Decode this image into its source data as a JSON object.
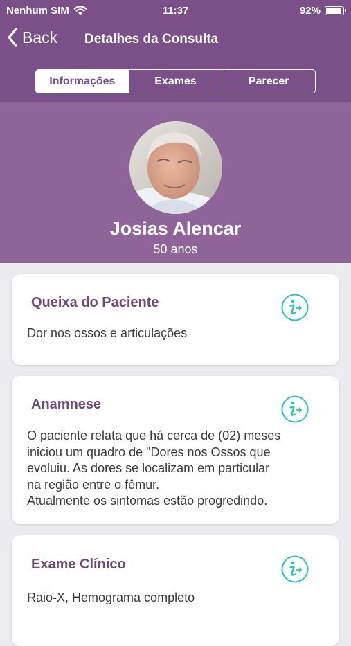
{
  "status_bar": {
    "carrier": "Nenhum SIM",
    "time": "11:37",
    "battery": "92%",
    "battery_level": 0.92,
    "icons": [
      "wifi-icon",
      "battery-icon"
    ]
  },
  "nav": {
    "back_label": "Back",
    "title": "Detalhes da Consulta"
  },
  "tabs": [
    {
      "label": "Informações",
      "active": true
    },
    {
      "label": "Exames",
      "active": false
    },
    {
      "label": "Parecer",
      "active": false
    }
  ],
  "patient": {
    "name": "Josias Alencar",
    "age": "50 anos"
  },
  "cards": [
    {
      "title": "Queixa do Paciente",
      "body": "Dor nos ossos e articulações",
      "icon": "info-icon"
    },
    {
      "title": "Anamnese",
      "body": "O paciente relata que há cerca de (02) meses\niniciou um quadro de \"Dores nos Ossos que\nevoluiu. As dores se localizam em particular\nna região entre o fêmur.\nAtualmente os sintomas estão progredindo.",
      "icon": "info-icon"
    },
    {
      "title": "Exame Clínico",
      "body": "Raio-X, Hemograma completo",
      "icon": "info-icon"
    }
  ],
  "colors": {
    "header": "#7b4f87",
    "profile_band": "#8f6498",
    "card_title": "#6d4a7a",
    "accent_icon": "#2bc3c0",
    "background": "#ececef"
  }
}
